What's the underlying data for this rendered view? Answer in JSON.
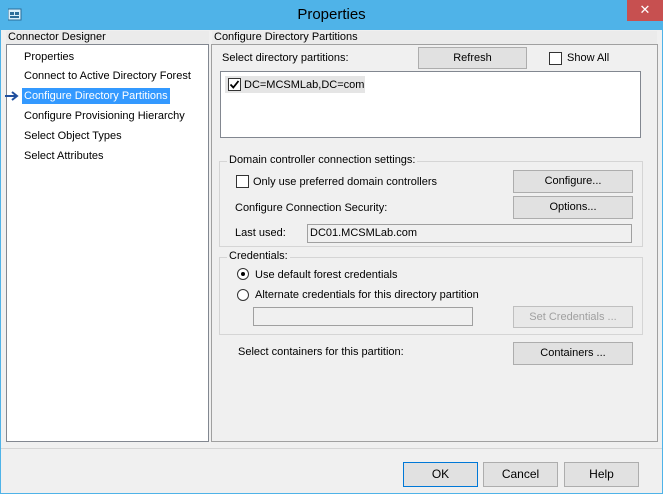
{
  "window": {
    "title": "Properties",
    "close_glyph": "✕",
    "app_icon": "window-app-icon",
    "close_color": "#c75050",
    "titlebar_color": "#4fb3e8"
  },
  "left_pane": {
    "header": "Connector Designer",
    "items": [
      {
        "label": "Properties",
        "selected": false
      },
      {
        "label": "Connect to Active Directory Forest",
        "selected": false
      },
      {
        "label": "Configure Directory Partitions",
        "selected": true
      },
      {
        "label": "Configure Provisioning Hierarchy",
        "selected": false
      },
      {
        "label": "Select Object Types",
        "selected": false
      },
      {
        "label": "Select Attributes",
        "selected": false
      }
    ],
    "selected_indicator": "arrow-right-icon",
    "selected_color": "#3399ff"
  },
  "right_pane": {
    "header": "Configure Directory Partitions",
    "select_partitions_label": "Select directory partitions:",
    "refresh_button": "Refresh",
    "show_all_label": "Show All",
    "show_all_checked": false,
    "partitions": [
      {
        "label": "DC=MCSMLab,DC=com",
        "checked": true
      }
    ],
    "dc_group": {
      "title": "Domain controller connection settings:",
      "preferred_dc_label": "Only use preferred domain controllers",
      "preferred_dc_checked": false,
      "configure_button": "Configure...",
      "connection_security_label": "Configure Connection Security:",
      "options_button": "Options...",
      "last_used_label": "Last used:",
      "last_used_value": "DC01.MCSMLab.com"
    },
    "credentials_group": {
      "title": "Credentials:",
      "default_option": "Use default forest credentials",
      "default_selected": true,
      "alternate_option": "Alternate credentials for this directory partition",
      "alternate_selected": false,
      "alternate_value": "",
      "set_credentials_button": "Set Credentials ..."
    },
    "containers_label": "Select containers for this partition:",
    "containers_button": "Containers ..."
  },
  "footer": {
    "ok": "OK",
    "cancel": "Cancel",
    "help": "Help"
  }
}
